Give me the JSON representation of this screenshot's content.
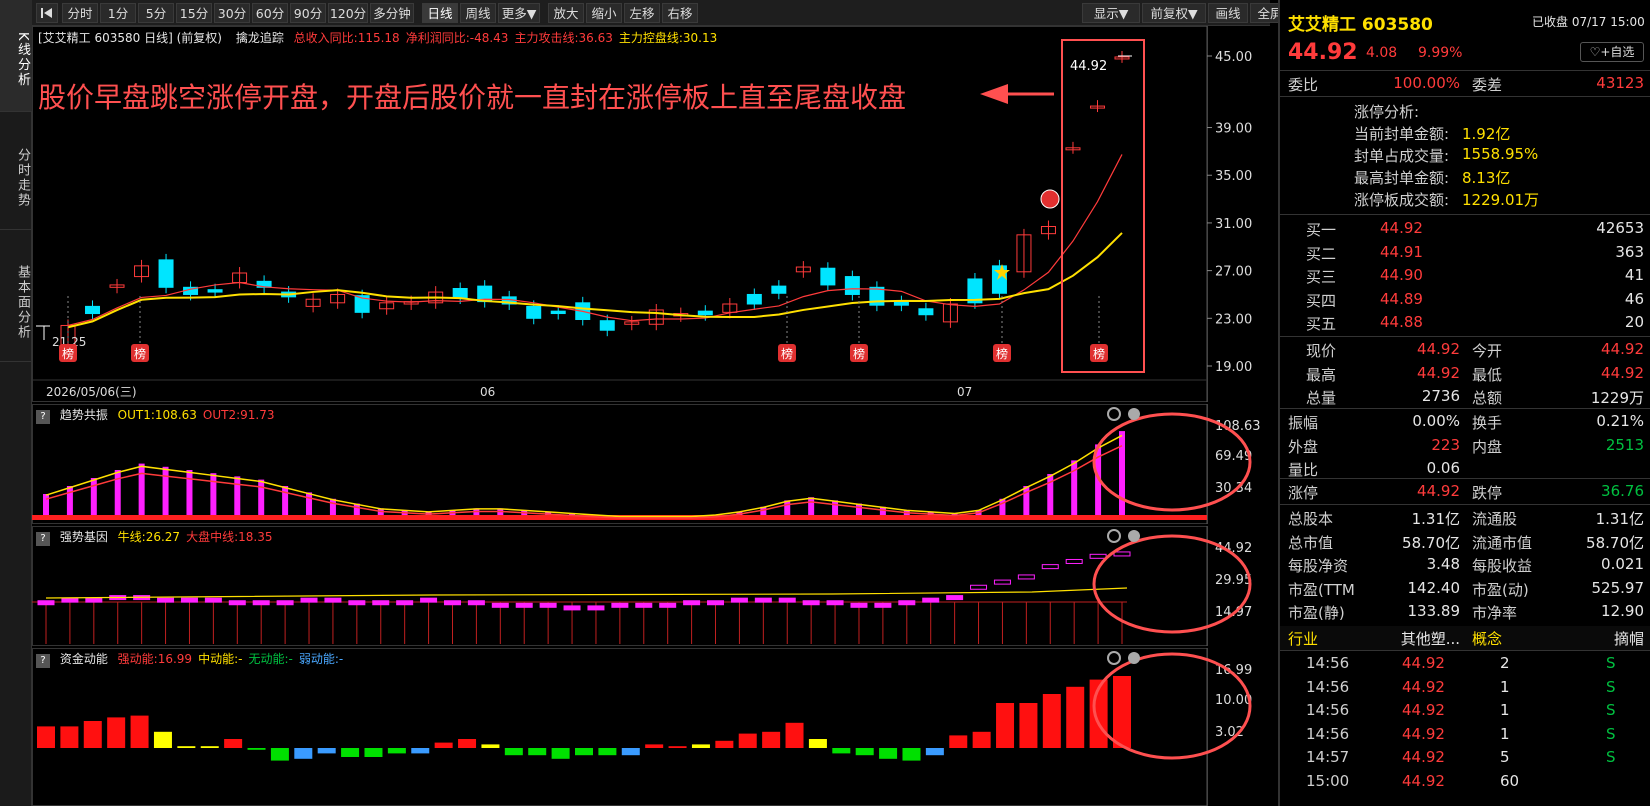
{
  "left_tabs": [
    "K线分析",
    "分时走势",
    "基本面分析"
  ],
  "toolbar_left": [
    "分时",
    "1分",
    "5分",
    "15分",
    "30分",
    "60分",
    "90分",
    "120分",
    "多分钟",
    "日线",
    "周线",
    "更多▼",
    "放大",
    "缩小",
    "左移",
    "右移"
  ],
  "toolbar_right": [
    "显示▼",
    "前复权▼",
    "画线",
    "全屏"
  ],
  "toolbar_back_icon": "play-back-icon",
  "main_chart": {
    "title": "[艾艾精工 603580 日线] (前复权)",
    "indicator_name": "擒龙追踪",
    "indicator_values": [
      {
        "text": "总收入同比:115.18",
        "color": "#ff3b3b"
      },
      {
        "text": "净利润同比:-48.43",
        "color": "#ff3b3b"
      },
      {
        "text": "主力攻击线:36.63",
        "color": "#ff3b3b"
      },
      {
        "text": "主力控盘线:30.13",
        "color": "#ffe000"
      }
    ],
    "annotation": "股价早盘跳空涨停开盘，开盘后股价就一直封在涨停板上直至尾盘收盘",
    "price_label": "44.92",
    "low_label": "21.25",
    "date_start": "2026/05/06(三)",
    "x_labels": [
      "06",
      "07"
    ],
    "y_ticks": [
      "45.00",
      "39.00",
      "35.00",
      "31.00",
      "27.00",
      "23.00",
      "19.00"
    ],
    "badge": "榜"
  },
  "sub1": {
    "name": "趋势共振",
    "items": [
      {
        "text": "OUT1:108.63",
        "color": "#ffe000"
      },
      {
        "text": "OUT2:91.73",
        "color": "#ff3b3b"
      }
    ],
    "y_ticks": [
      "108.63",
      "69.49",
      "30.34"
    ]
  },
  "sub2": {
    "name": "强势基因",
    "items": [
      {
        "text": "牛线:26.27",
        "color": "#ffe000"
      },
      {
        "text": "大盘中线:18.35",
        "color": "#ff3b3b"
      }
    ],
    "y_ticks": [
      "44.92",
      "29.95",
      "14.97"
    ]
  },
  "sub3": {
    "name": "资金动能",
    "items": [
      {
        "text": "强动能:16.99",
        "color": "#ff3b3b"
      },
      {
        "text": "中动能:-",
        "color": "#ffe000"
      },
      {
        "text": "无动能:-",
        "color": "#00c040"
      },
      {
        "text": "弱动能:-",
        "color": "#4aa8ff"
      }
    ],
    "y_ticks": [
      "16.99",
      "10.00",
      "3.02"
    ]
  },
  "chart_data": {
    "type": "candlestick",
    "x_range": [
      "2026-05-06",
      "2026-07-17"
    ],
    "ylim": [
      19,
      45
    ],
    "last_close": 44.92,
    "low_marker": 21.25,
    "moving_averages": [
      {
        "name": "主力攻击线",
        "color": "#ff3b3b"
      },
      {
        "name": "主力控盘线",
        "color": "#ffe000"
      }
    ]
  },
  "quote": {
    "name_code": "艾艾精工 603580",
    "status": "已收盘 07/17 15:00",
    "price": "44.92",
    "change": "4.08",
    "change_pct": "9.99%",
    "watch_button": "+自选",
    "weibi_label": "委比",
    "weibi": "100.00%",
    "weicha_label": "委差",
    "weicha": "43123",
    "limit_title": "涨停分析:",
    "limit_rows": [
      {
        "label": "当前封单金额:",
        "value": "1.92亿"
      },
      {
        "label": "封单占成交量:",
        "value": "1558.95%"
      },
      {
        "label": "最高封单金额:",
        "value": "8.13亿"
      },
      {
        "label": "涨停板成交额:",
        "value": "1229.01万"
      }
    ],
    "bids": [
      {
        "label": "买一",
        "price": "44.92",
        "vol": "42653"
      },
      {
        "label": "买二",
        "price": "44.91",
        "vol": "363"
      },
      {
        "label": "买三",
        "price": "44.90",
        "vol": "41"
      },
      {
        "label": "买四",
        "price": "44.89",
        "vol": "46"
      },
      {
        "label": "买五",
        "price": "44.88",
        "vol": "20"
      }
    ],
    "stats": [
      {
        "l1": "现价",
        "v1": "44.92",
        "c1": "red",
        "l2": "今开",
        "v2": "44.92",
        "c2": "red"
      },
      {
        "l1": "最高",
        "v1": "44.92",
        "c1": "red",
        "l2": "最低",
        "v2": "44.92",
        "c2": "red"
      },
      {
        "l1": "总量",
        "v1": "2736",
        "c1": "wht",
        "l2": "总额",
        "v2": "1229万",
        "c2": "wht"
      }
    ],
    "stats2": [
      {
        "l1": "振幅",
        "v1": "0.00%",
        "c1": "wht",
        "l2": "换手",
        "v2": "0.21%",
        "c2": "wht"
      },
      {
        "l1": "外盘",
        "v1": "223",
        "c1": "red",
        "l2": "内盘",
        "v2": "2513",
        "c2": "green"
      },
      {
        "l1": "量比",
        "v1": "0.06",
        "c1": "wht",
        "l2": "",
        "v2": "",
        "c2": "wht"
      }
    ],
    "limits": {
      "l1": "涨停",
      "v1": "44.92",
      "l2": "跌停",
      "v2": "36.76"
    },
    "fund": [
      {
        "l1": "总股本",
        "v1": "1.31亿",
        "l2": "流通股",
        "v2": "1.31亿"
      },
      {
        "l1": "总市值",
        "v1": "58.70亿",
        "l2": "流通市值",
        "v2": "58.70亿"
      },
      {
        "l1": "每股净资",
        "v1": "3.48",
        "l2": "每股收益",
        "v2": "0.021"
      },
      {
        "l1": "市盈(TTM",
        "v1": "142.40",
        "l2": "市盈(动)",
        "v2": "525.97"
      },
      {
        "l1": "市盈(静)",
        "v1": "133.89",
        "l2": "市净率",
        "v2": "12.90"
      }
    ],
    "industry": {
      "l1": "行业",
      "v1": "其他塑...",
      "l2": "概念",
      "v2": "摘帽"
    },
    "ticks": [
      {
        "t": "14:56",
        "p": "44.92",
        "v": "2",
        "s": "S"
      },
      {
        "t": "14:56",
        "p": "44.92",
        "v": "1",
        "s": "S"
      },
      {
        "t": "14:56",
        "p": "44.92",
        "v": "1",
        "s": "S"
      },
      {
        "t": "14:56",
        "p": "44.92",
        "v": "1",
        "s": "S"
      },
      {
        "t": "14:57",
        "p": "44.92",
        "v": "5",
        "s": "S"
      },
      {
        "t": "15:00",
        "p": "44.92",
        "v": "60",
        "s": ""
      }
    ]
  }
}
